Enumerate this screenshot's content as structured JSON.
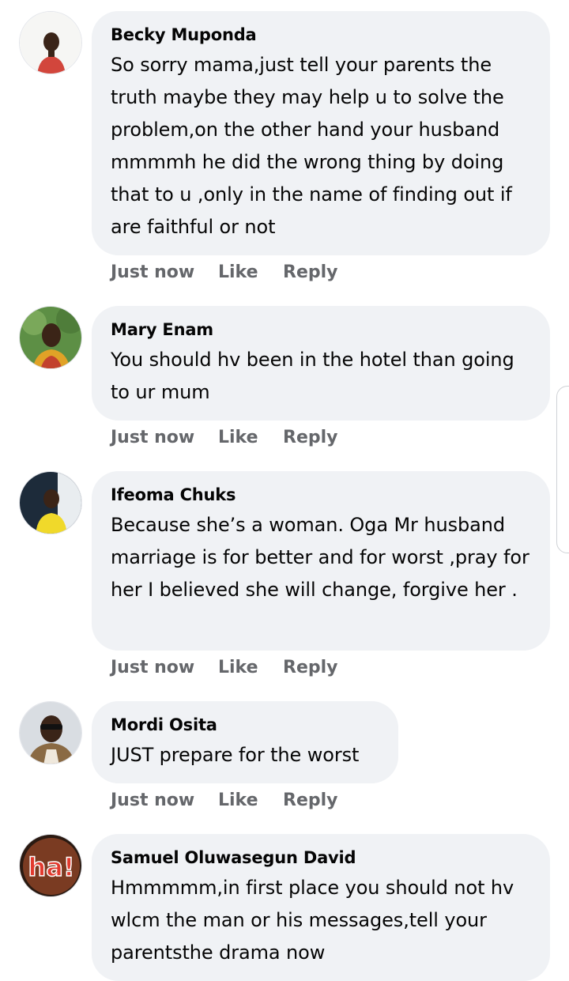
{
  "comments": [
    {
      "author": "Becky Muponda",
      "text": "So sorry mama,just tell your parents the truth maybe they may help u to solve the problem,on the other hand your husband mmmmh he did the wrong thing by doing that to u ,only in the name of finding out if are faithful or not",
      "time": "Just now",
      "like": "Like",
      "reply": "Reply",
      "avatar": "profile-photo-person-red-shirt"
    },
    {
      "author": "Mary Enam",
      "text": "You should hv been in the hotel than going to ur mum",
      "time": "Just now",
      "like": "Like",
      "reply": "Reply",
      "avatar": "profile-photo-person-outdoors"
    },
    {
      "author": "Ifeoma Chuks",
      "text": "Because she’s a woman. Oga Mr husband marriage is for better and for worst ,pray for her I believed she will change, forgive her .",
      "time": "Just now",
      "like": "Like",
      "reply": "Reply",
      "avatar": "profile-photo-person-yellow-shirt"
    },
    {
      "author": "Mordi Osita",
      "text": "JUST prepare for the worst",
      "time": "Just now",
      "like": "Like",
      "reply": "Reply",
      "avatar": "profile-photo-man-sunglasses"
    },
    {
      "author": "Samuel Oluwasegun David",
      "text": "Hmmmmm,in first place you should not hv wlcm the man or his messages,tell your parentsthe drama now",
      "time": "Just now",
      "like": "Like",
      "reply": "Reply",
      "avatar": "profile-photo-ha-graphic",
      "avatar_text": "ha!"
    }
  ],
  "colors": {
    "bubble": "#f0f2f5",
    "action_text": "#65676b",
    "text": "#050505"
  }
}
